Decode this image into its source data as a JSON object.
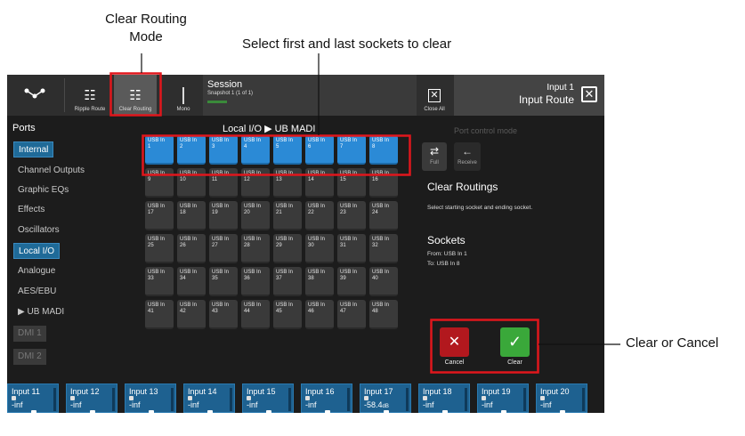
{
  "annotations": {
    "clear_routing_mode_line1": "Clear Routing",
    "clear_routing_mode_line2": "Mode",
    "select_sockets": "Select first and last sockets to clear",
    "clear_or_cancel": "Clear or Cancel"
  },
  "topbar": {
    "ripple_route_label": "Ripple Route",
    "clear_routing_label": "Clear Routing",
    "mono_label": "Mono",
    "session_title": "Session",
    "session_snapshot": "Snapshot 1 (1 of 1)",
    "close_all_label": "Close All",
    "route_input": "Input 1",
    "route_title": "Input Route"
  },
  "sidebar": {
    "header": "Ports",
    "items": [
      {
        "label": "Internal",
        "active": true
      },
      {
        "label": "Channel Outputs"
      },
      {
        "label": "Graphic EQs"
      },
      {
        "label": "Effects"
      },
      {
        "label": "Oscillators"
      },
      {
        "label": "Local I/O",
        "active": true
      },
      {
        "label": "Analogue"
      },
      {
        "label": "AES/EBU"
      },
      {
        "label": "▶ UB MADI"
      },
      {
        "label": "DMI 1",
        "disabled": true
      },
      {
        "label": "DMI 2",
        "disabled": true
      }
    ]
  },
  "grid": {
    "title": "Local I/O ▶ UB MADI",
    "socket_prefix": "USB In",
    "count": 48,
    "selected_from": 1,
    "selected_to": 8
  },
  "right_panel": {
    "port_control_mode": "Port control mode",
    "full_label": "Full",
    "receive_label": "Receive",
    "clear_routings_title": "Clear Routings",
    "clear_routings_desc": "Select starting socket and ending socket.",
    "sockets_title": "Sockets",
    "from_text": "From: USB In 1",
    "to_text": "To: USB In 8",
    "cancel_label": "Cancel",
    "clear_label": "Clear"
  },
  "channels": [
    {
      "name": "Input 11",
      "value": "-inf"
    },
    {
      "name": "Input 12",
      "value": "-inf"
    },
    {
      "name": "Input 13",
      "value": "-inf"
    },
    {
      "name": "Input 14",
      "value": "-inf"
    },
    {
      "name": "Input 15",
      "value": "-inf"
    },
    {
      "name": "Input 16",
      "value": "-inf"
    },
    {
      "name": "Input 17",
      "value": "-58.4",
      "unit": "dB"
    },
    {
      "name": "Input 18",
      "value": "-inf"
    },
    {
      "name": "Input 19",
      "value": "-inf"
    },
    {
      "name": "Input 20",
      "value": "-inf"
    }
  ],
  "colors": {
    "highlight_red": "#e0161c",
    "selected_blue": "#2b8ad6",
    "cancel_red": "#b2181e",
    "clear_green": "#3aa83a"
  }
}
